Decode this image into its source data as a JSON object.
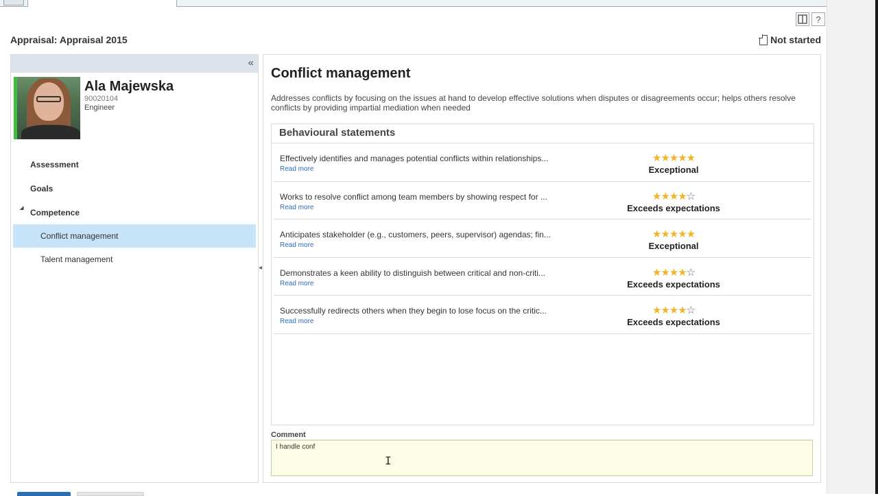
{
  "header": {
    "title": "Appraisal: Appraisal 2015",
    "status": "Not started",
    "help_glyph": "?"
  },
  "employee": {
    "name": "Ala Majewska",
    "id": "90020104",
    "role": "Engineer"
  },
  "nav": {
    "collapse_glyph": "«",
    "items": [
      {
        "label": "Assessment"
      },
      {
        "label": "Goals"
      },
      {
        "label": "Competence"
      }
    ],
    "sub_items": [
      {
        "label": "Conflict management",
        "active": true
      },
      {
        "label": "Talent management",
        "active": false
      }
    ]
  },
  "competency": {
    "title": "Conflict management",
    "description": "Addresses conflicts by focusing on the issues at hand to develop effective solutions when disputes or disagreements occur; helps others resolve conflicts by providing impartial mediation when needed",
    "statements_header": "Behavioural statements",
    "read_more": "Read more",
    "statements": [
      {
        "text": "Effectively identifies and manages potential conflicts within relationships...",
        "stars": "★★★★★",
        "empty": "",
        "rating_label": "Exceptional"
      },
      {
        "text": "Works to resolve conflict among team members by showing respect for ...",
        "stars": "★★★★",
        "empty": "☆",
        "rating_label": "Exceeds expectations"
      },
      {
        "text": "Anticipates stakeholder (e.g., customers, peers, supervisor) agendas; fin...",
        "stars": "★★★★★",
        "empty": "",
        "rating_label": "Exceptional"
      },
      {
        "text": "Demonstrates a keen ability to distinguish between critical and non-criti...",
        "stars": "★★★★",
        "empty": "☆",
        "rating_label": "Exceeds expectations"
      },
      {
        "text": "Successfully redirects others when they begin to lose focus on the critic...",
        "stars": "★★★★",
        "empty": "☆",
        "rating_label": "Exceeds expectations"
      }
    ]
  },
  "comment": {
    "label": "Comment",
    "value": "I handle conf"
  },
  "colors": {
    "accent": "#2a6db5",
    "active_nav": "#c7e3f7",
    "star": "#f0b429",
    "presence": "#3fbd3f",
    "comment_bg": "#fdfde6"
  }
}
